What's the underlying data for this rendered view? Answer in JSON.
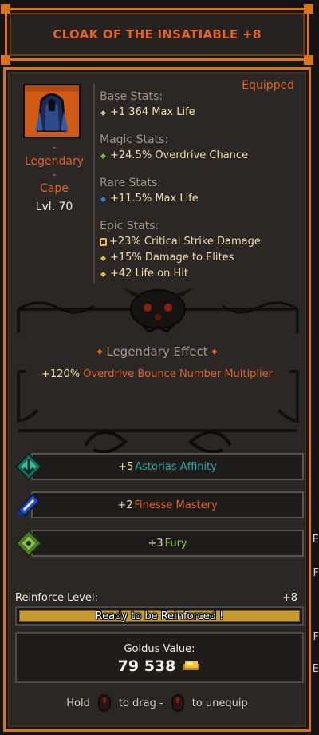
{
  "title": "CLOAK OF THE INSATIABLE +8",
  "equipped_label": "Equipped",
  "item": {
    "icon": "cloak-icon",
    "rarity_lines": [
      "-",
      "Legendary",
      "-",
      "Cape"
    ],
    "level": "Lvl. 70"
  },
  "stats": {
    "base": {
      "header": "Base Stats:",
      "lines": [
        "+1 364 Max Life"
      ]
    },
    "magic": {
      "header": "Magic Stats:",
      "lines": [
        "+24.5% Overdrive Chance"
      ]
    },
    "rare": {
      "header": "Rare Stats:",
      "lines": [
        "+11.5% Max Life"
      ]
    },
    "epic": {
      "header": "Epic Stats:",
      "lines": [
        "+23% Critical Strike Damage",
        "+15% Damage to Elites",
        "+42 Life on Hit"
      ]
    }
  },
  "legendary": {
    "title": "Legendary Effect",
    "prefix": "+120%",
    "text": " Overdrive Bounce Number Multiplier"
  },
  "affinities": [
    {
      "value": "+5",
      "name": " Astorias Affinity",
      "color": "#2fa8a8",
      "icon": "astorias-rune-icon"
    },
    {
      "value": "+2",
      "name": " Finesse Mastery",
      "color": "#e2622a",
      "icon": "finesse-rune-icon"
    },
    {
      "value": "+3",
      "name": " Fury",
      "color": "#8ec24a",
      "icon": "fury-rune-icon"
    }
  ],
  "reinforce": {
    "label": "Reinforce Level:",
    "value": "+8",
    "status": "Ready to be Reinforced !",
    "progress": 1.0
  },
  "goldus": {
    "label": "Goldus Value:",
    "value": "79 538",
    "icon": "goldus-coin-icon"
  },
  "hint": {
    "hold": "Hold",
    "drag": "to drag -",
    "unequip": "to unequip",
    "icon": "mouse-icon"
  },
  "edge_text": [
    "E",
    "F",
    "F",
    "E"
  ]
}
